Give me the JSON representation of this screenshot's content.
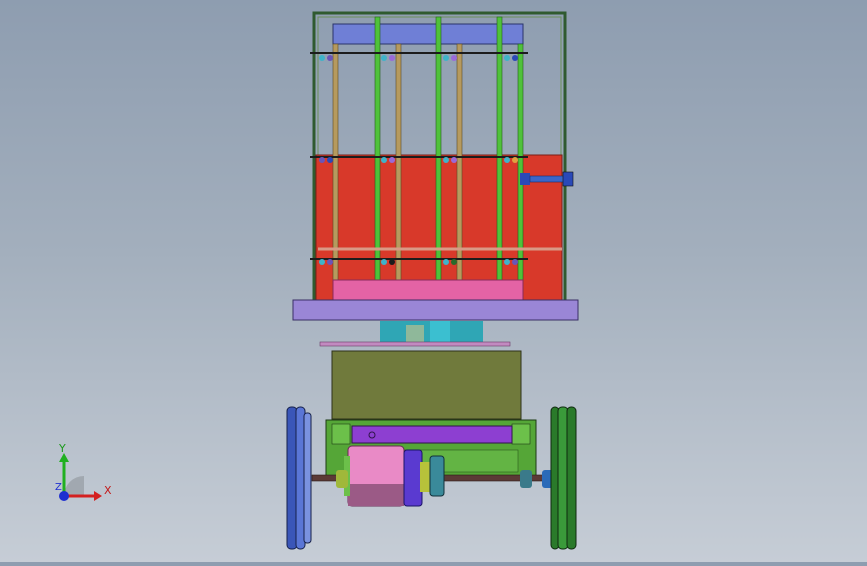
{
  "viewport": {
    "background_top": "#8e9db0",
    "background_bottom": "#c6cdd6"
  },
  "model": {
    "colors": {
      "frame": "#2f5a2f",
      "top_plate": "#6f7fd6",
      "rod_green": "#4fc23a",
      "rod_tan": "#b69a5e",
      "red_panel": "#d8392a",
      "pink_plate": "#e463a5",
      "base_plate": "#9a86d6",
      "cylinder": "#2fa6b5",
      "olive_box": "#707a3c",
      "chassis_green": "#55a637",
      "purple_bar": "#8d3fd1",
      "motor_pink": "#e98ac6",
      "wheel_blue": "#5a76d6",
      "wheel_green": "#3a9a3a",
      "axle": "#5b3a36"
    }
  },
  "triad": {
    "x_label": "X",
    "y_label": "Y",
    "z_label": "Z",
    "x_color": "#d42020",
    "y_color": "#20b020",
    "z_color": "#1e2fd0"
  }
}
